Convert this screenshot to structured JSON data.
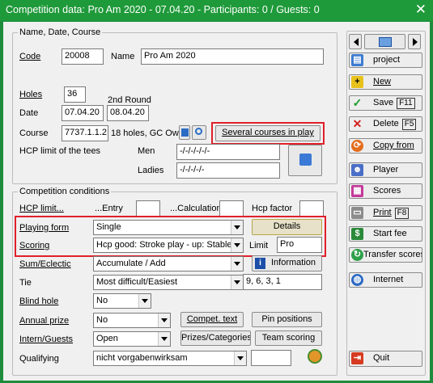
{
  "window": {
    "title": "Competition data: Pro Am 2020 - 07.04.20 - Participants: 0 / Guests: 0",
    "close_glyph": "✕"
  },
  "name_group": {
    "title": "Name, Date, Course",
    "code_label": "Code",
    "code_value": "20008",
    "name_label": "Name",
    "name_value": "Pro Am 2020",
    "holes_label": "Holes",
    "holes_value": "36",
    "second_round_label": "2nd Round",
    "date_label": "Date",
    "date_value": "07.04.20",
    "second_round_date": "08.04.20",
    "course_label": "Course",
    "course_value": "7737.1.1.2",
    "course_desc": "18 holes, GC Owi",
    "several_courses_label": "Several courses in play",
    "hcp_limit_tees_label": "HCP limit of the tees",
    "men_label": "Men",
    "men_value": "-/-/-/-/-/-",
    "ladies_label": "Ladies",
    "ladies_value": "-/-/-/-/-"
  },
  "conditions_group": {
    "title": "Competition conditions",
    "hcp_limit_label": "HCP limit...",
    "entry_label": "...Entry",
    "entry_value": "",
    "calculation_label": "...Calculation",
    "calculation_value": "",
    "hcp_factor_label": "Hcp factor",
    "hcp_factor_value": "",
    "playing_form_label": "Playing form",
    "playing_form_value": "Single",
    "details_label": "Details",
    "scoring_label": "Scoring",
    "scoring_value": "Hcp good: Stroke play - up: Stable",
    "limit_label": "Limit",
    "limit_value": "Pro",
    "sum_eclectic_label": "Sum/Eclectic",
    "sum_eclectic_value": "Accumulate / Add",
    "information_label": "Information",
    "tie_label": "Tie",
    "tie_value": "Most difficult/Easiest",
    "tie_holes": "9, 6, 3, 1",
    "blind_hole_label": "Blind hole",
    "blind_hole_value": "No",
    "annual_prize_label": "Annual prize",
    "annual_prize_value": "No",
    "compet_text_label": "Compet. text",
    "pin_positions_label": "Pin positions",
    "intern_guests_label": "Intern/Guests",
    "intern_guests_value": "Open",
    "prizes_label": "Prizes/Categories",
    "team_scoring_label": "Team scoring",
    "qualifying_label": "Qualifying",
    "qualifying_value": "nicht vorgabenwirksam",
    "qualifying_extra": ""
  },
  "sidebar": {
    "project": "project",
    "new": "New",
    "save": "Save",
    "save_key": "F11",
    "delete": "Delete",
    "delete_key": "F5",
    "copy_from": "Copy from",
    "player": "Player",
    "scores": "Scores",
    "print": "Print",
    "print_key": "F8",
    "start_fee": "Start fee",
    "transfer_scores": "Transfer scores",
    "internet": "Internet",
    "quit": "Quit"
  }
}
